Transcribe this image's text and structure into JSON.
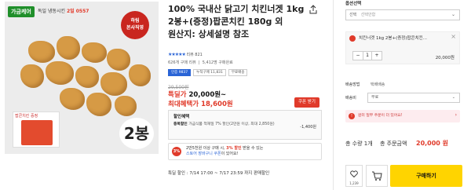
{
  "product": {
    "title": "100% 국내산 닭고기 치킨너겟 1kg 2봉+(증정)팝콘치킨 180g 외",
    "origin": "원산지: 상세설명 참조",
    "brand_logo": "가금케어",
    "promo_banner": {
      "prefix": "독일 냉동시킨",
      "highlight": "2일 0557"
    },
    "halal_badge": [
      "하림",
      "본사직영"
    ],
    "thumb_label": "팝콘치킨 증정",
    "count_badge": "2봉"
  },
  "rating": {
    "stars": "★★★★★",
    "text": "리뷰 821"
  },
  "stats": {
    "reviews": "626개 구매 리뷰",
    "purchase": "5,412명 구매완료"
  },
  "tags": [
    "인증 9837",
    "누적구매 11,831",
    "무료배송"
  ],
  "pricing": {
    "original": "29,500원",
    "sale_label": "특딜가",
    "sale_value": "20,000원~",
    "best_label": "최대혜택가",
    "best_value": "18,600원",
    "coupon_button": "쿠폰 받기"
  },
  "discount": {
    "title": "할인혜택",
    "detail_label": "중복할인",
    "detail_text": "가금식품 적재일 7% 할인(2만원 이상, 최대 2,850원)",
    "amount": "-1,400원"
  },
  "benefit": {
    "icon": "3%",
    "line1_prefix": "2만5천원 이상 구매 시,",
    "line1_highlight": "3% 할인",
    "line1_suffix": "받을 수 있는",
    "line2_link": "스토어 장바구니 쿠폰",
    "line2_suffix": "이 있어요!"
  },
  "special_sale": "특딜 할인 : 7/14 17:00 ~ 7/17 23:59 까지 판매할인",
  "order": {
    "option_label": "옵션선택",
    "option_select_label": "선택",
    "option_select_placeholder": "선택안함",
    "item_name": "치킨너겟 1kg 2봉+(증정)팝콘치킨...",
    "item_close": "×",
    "qty_minus": "−",
    "qty_value": "1",
    "qty_plus": "+",
    "item_price": "20,000원",
    "shipping_method_label": "배송방법",
    "shipping_method_value": "택배배송",
    "shipping_fee_label": "배송비",
    "shipping_fee_value": "무료",
    "notice": "원미 일부 주문이 더 있어요!",
    "total_qty": "총 수량 1개",
    "total_price_label": "총 주문금액",
    "total_price": "20,000 원",
    "like_count": "1,239",
    "buy_button": "구매하기"
  },
  "colors": {
    "accent_red": "#e03a2a",
    "buy_yellow": "#ffd400",
    "brand_green": "#1f8f2a",
    "link_blue": "#2a64d6"
  }
}
